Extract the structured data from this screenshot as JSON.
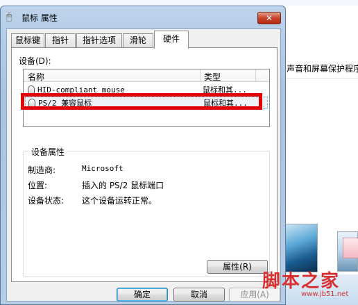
{
  "dialog": {
    "title": "鼠标 属性",
    "close_label": "✕",
    "tabs": [
      "鼠标键",
      "指针",
      "指针选项",
      "滑轮",
      "硬件"
    ],
    "active_tab": "硬件"
  },
  "devices": {
    "label": "设备(D):",
    "columns": {
      "name": "名称",
      "type": "类型"
    },
    "rows": [
      {
        "name": "HID-compliant mouse",
        "type": "鼠标和其..."
      },
      {
        "name": "PS/2 兼容鼠标",
        "type": "鼠标和其...",
        "selected": true
      }
    ]
  },
  "properties": {
    "title": "设备属性",
    "manufacturer_label": "制造商:",
    "manufacturer_value": "Microsoft",
    "location_label": "位置:",
    "location_value": "插入的 PS/2 鼠标端口",
    "status_label": "设备状态:",
    "status_value": "这个设备运转正常。",
    "button": "属性(R)"
  },
  "footer": {
    "ok": "确定",
    "cancel": "取消",
    "apply": "应用(A)"
  },
  "background": {
    "text": "声音和屏幕保护程序"
  },
  "watermark": {
    "logo": "脚本之家",
    "url": "www.jb51.net"
  },
  "colors": {
    "highlight": "#e30000",
    "close_button": "#c8442b",
    "watermark": "#d83030"
  },
  "icons": {
    "title": "mouse-icon",
    "device": "mouse-icon"
  }
}
